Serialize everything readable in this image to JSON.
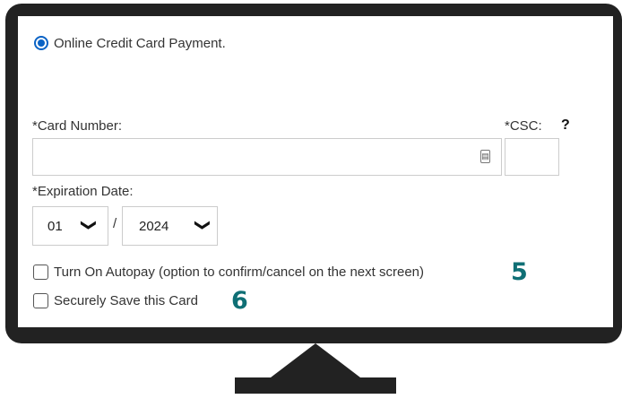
{
  "payment": {
    "option_label": "Online Credit Card Payment.",
    "card_number_label": "*Card Number:",
    "card_number_value": "",
    "card_icon_symbol": "▤",
    "csc_label": "*CSC:",
    "csc_help": "?",
    "csc_value": "",
    "expiration_label": "*Expiration Date:",
    "month_value": "01",
    "date_separator": "/",
    "year_value": "2024",
    "autopay_label": "Turn On Autopay (option to confirm/cancel on the next screen)",
    "save_card_label": "Securely Save this Card"
  },
  "annotations": {
    "step_autopay": "5",
    "step_save_card": "6"
  },
  "colors": {
    "radio_selected": "#0b63c5",
    "monitor_frame": "#222222",
    "step_number": "#0f6f75"
  }
}
